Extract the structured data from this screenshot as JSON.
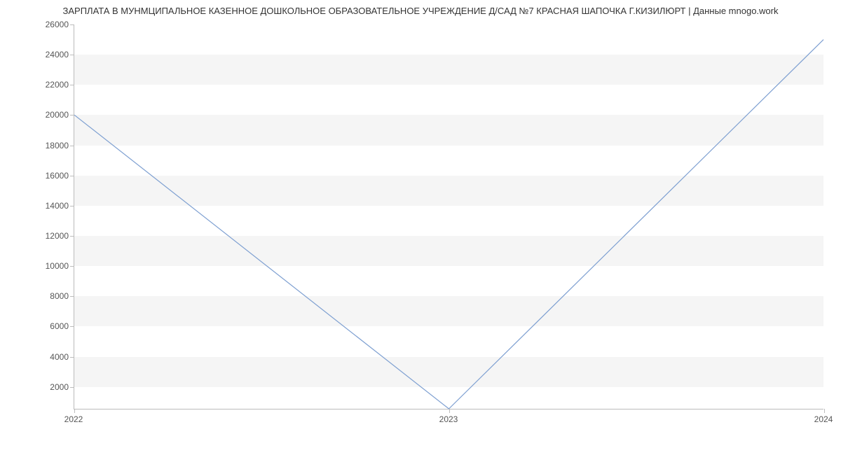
{
  "chart_data": {
    "type": "line",
    "title": "ЗАРПЛАТА В МУНМЦИПАЛЬНОЕ КАЗЕННОЕ ДОШКОЛЬНОЕ ОБРАЗОВАТЕЛЬНОЕ УЧРЕЖДЕНИЕ  Д/САД №7 КРАСНАЯ ШАПОЧКА Г.КИЗИЛЮРТ | Данные mnogo.work",
    "x": [
      2022,
      2023,
      2024
    ],
    "values": [
      20000,
      500,
      25000
    ],
    "xlabel": "",
    "ylabel": "",
    "xlim": [
      2022,
      2024
    ],
    "ylim": [
      500,
      26000
    ],
    "y_ticks": [
      2000,
      4000,
      6000,
      8000,
      10000,
      12000,
      14000,
      16000,
      18000,
      20000,
      22000,
      24000,
      26000
    ],
    "x_ticks": [
      2022,
      2023,
      2024
    ],
    "colors": {
      "line": "#7d9fd1",
      "band": "#f5f5f5",
      "axis": "#bbbbbb",
      "text": "#555555"
    }
  }
}
